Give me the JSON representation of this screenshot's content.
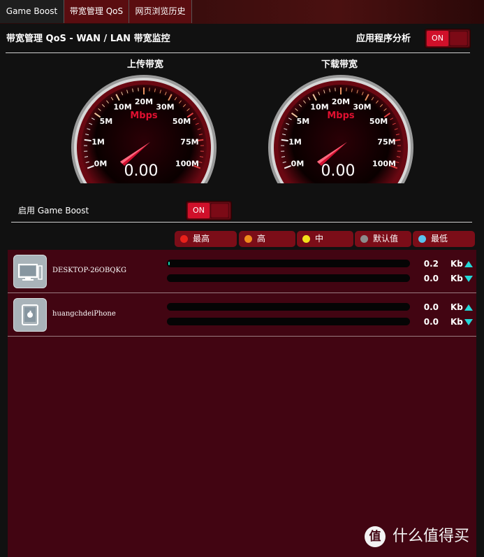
{
  "tabs": [
    {
      "label": "Game Boost",
      "active": true
    },
    {
      "label": "带宽管理 QoS",
      "active": false
    },
    {
      "label": "网页浏览历史",
      "active": false
    }
  ],
  "header": {
    "title": "带宽管理 QoS - WAN / LAN 带宽监控",
    "app_analysis_label": "应用程序分析",
    "app_analysis_toggle": "ON"
  },
  "gauges": [
    {
      "title": "上传带宽",
      "unit": "Mbps",
      "value": "0.00",
      "ticks": [
        "0M",
        "1M",
        "5M",
        "10M",
        "20M",
        "30M",
        "50M",
        "75M",
        "100M"
      ]
    },
    {
      "title": "下载带宽",
      "unit": "Mbps",
      "value": "0.00",
      "ticks": [
        "0M",
        "1M",
        "5M",
        "10M",
        "20M",
        "30M",
        "50M",
        "75M",
        "100M"
      ]
    }
  ],
  "game_boost": {
    "label": "启用 Game Boost",
    "toggle": "ON"
  },
  "priorities": [
    {
      "label": "最高",
      "color": "#e8211a"
    },
    {
      "label": "高",
      "color": "#f08c1c"
    },
    {
      "label": "中",
      "color": "#f2e11a"
    },
    {
      "label": "默认值",
      "color": "#8c8c8c"
    },
    {
      "label": "最低",
      "color": "#5ac2ee"
    }
  ],
  "devices": [
    {
      "name": "DESKTOP-26OBQKG",
      "icon": "desktop-computer-icon",
      "upload": "0.2",
      "download": "0.0",
      "unit": "Kb",
      "upload_fill": 0.003
    },
    {
      "name": "huangchdeiPhone",
      "icon": "apple-device-icon",
      "upload": "0.0",
      "download": "0.0",
      "unit": "Kb",
      "upload_fill": 0
    }
  ],
  "watermark": {
    "icon": "值",
    "text": "什么值得买"
  }
}
